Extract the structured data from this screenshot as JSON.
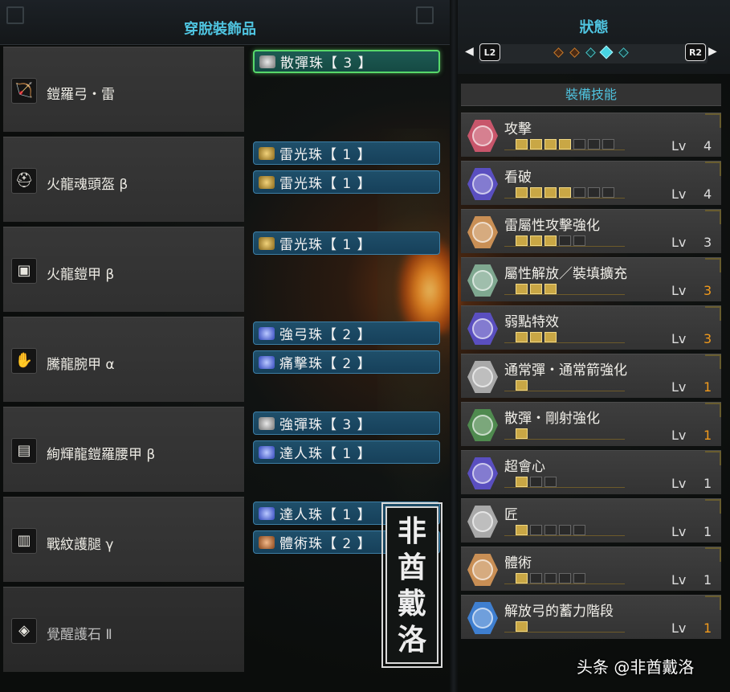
{
  "left_panel": {
    "title": "穿脫裝飾品",
    "equipment": [
      {
        "name": "鎧羅弓・雷",
        "icon": "bow-icon",
        "icon_glyph": "🏹",
        "dim": false,
        "slots": [
          {
            "label": "散彈珠【 3 】",
            "jewel": "silver",
            "selected": true
          }
        ]
      },
      {
        "name": "火龍魂頭盔 β",
        "icon": "helmet-icon",
        "icon_glyph": "⛑",
        "dim": false,
        "slots": [
          {
            "label": "雷光珠【 1 】",
            "jewel": "gold",
            "selected": false
          },
          {
            "label": "雷光珠【 1 】",
            "jewel": "gold",
            "selected": false
          }
        ]
      },
      {
        "name": "火龍鎧甲 β",
        "icon": "chest-armor-icon",
        "icon_glyph": "▣",
        "dim": false,
        "slots": [
          {
            "label": "雷光珠【 1 】",
            "jewel": "gold",
            "selected": false
          }
        ]
      },
      {
        "name": "騰龍腕甲 α",
        "icon": "gauntlet-icon",
        "icon_glyph": "✋",
        "dim": false,
        "slots": [
          {
            "label": "強弓珠【 2 】",
            "jewel": "blue",
            "selected": false
          },
          {
            "label": "痛擊珠【 2 】",
            "jewel": "blue",
            "selected": false
          }
        ]
      },
      {
        "name": "絢輝龍鎧羅腰甲 β",
        "icon": "waist-armor-icon",
        "icon_glyph": "▤",
        "dim": false,
        "slots": [
          {
            "label": "強彈珠【 3 】",
            "jewel": "silver",
            "selected": false
          },
          {
            "label": "達人珠【 1 】",
            "jewel": "blue",
            "selected": false
          }
        ]
      },
      {
        "name": "戰紋護腿 γ",
        "icon": "leg-armor-icon",
        "icon_glyph": "▥",
        "dim": false,
        "slots": [
          {
            "label": "達人珠【 1 】",
            "jewel": "blue",
            "selected": false
          },
          {
            "label": "體術珠【 2 】",
            "jewel": "bronze",
            "selected": false
          }
        ]
      },
      {
        "name": "覺醒護石 Ⅱ",
        "icon": "charm-icon",
        "icon_glyph": "◈",
        "dim": true,
        "slots": []
      }
    ],
    "stamp_chars": [
      "非",
      "酋",
      "戴",
      "洛"
    ]
  },
  "right_panel": {
    "title": "狀態",
    "left_shoulder": "L2",
    "right_shoulder": "R2",
    "skills_header": "裝備技能",
    "lv_label": "Lv",
    "skills": [
      {
        "name": "攻擊",
        "level": "4",
        "filled": 4,
        "total": 7,
        "max": false,
        "gem_color": "#c8566b"
      },
      {
        "name": "看破",
        "level": "4",
        "filled": 4,
        "total": 7,
        "max": false,
        "gem_color": "#5a4fc0"
      },
      {
        "name": "雷屬性攻擊強化",
        "level": "3",
        "filled": 3,
        "total": 5,
        "max": false,
        "gem_color": "#c98f55"
      },
      {
        "name": "屬性解放／裝填擴充",
        "level": "3",
        "filled": 3,
        "total": 3,
        "max": true,
        "gem_color": "#7fa890"
      },
      {
        "name": "弱點特效",
        "level": "3",
        "filled": 3,
        "total": 3,
        "max": true,
        "gem_color": "#5a4fc0"
      },
      {
        "name": "通常彈・通常箭強化",
        "level": "1",
        "filled": 1,
        "total": 1,
        "max": true,
        "gem_color": "#a9a9a9"
      },
      {
        "name": "散彈・剛射強化",
        "level": "1",
        "filled": 1,
        "total": 1,
        "max": true,
        "gem_color": "#4f8a4f"
      },
      {
        "name": "超會心",
        "level": "1",
        "filled": 1,
        "total": 3,
        "max": false,
        "gem_color": "#5a4fc0"
      },
      {
        "name": "匠",
        "level": "1",
        "filled": 1,
        "total": 5,
        "max": false,
        "gem_color": "#a9a9a9"
      },
      {
        "name": "體術",
        "level": "1",
        "filled": 1,
        "total": 5,
        "max": false,
        "gem_color": "#c98f55"
      },
      {
        "name": "解放弓的蓄力階段",
        "level": "1",
        "filled": 1,
        "total": 1,
        "max": true,
        "gem_color": "#3f7fd0"
      }
    ]
  },
  "watermark": "头条 @非酋戴洛"
}
